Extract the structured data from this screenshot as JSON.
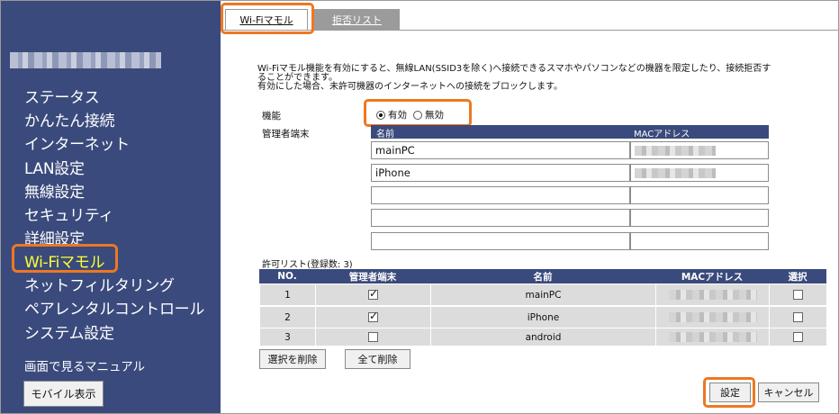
{
  "sidebar": {
    "nav": [
      {
        "label": "ステータス"
      },
      {
        "label": "かんたん接続"
      },
      {
        "label": "インターネット"
      },
      {
        "label": "LAN設定"
      },
      {
        "label": "無線設定"
      },
      {
        "label": "セキュリティ"
      },
      {
        "label": "詳細設定"
      },
      {
        "label": "Wi-Fiマモル"
      },
      {
        "label": "ネットフィルタリング"
      },
      {
        "label": "ペアレンタルコントロール"
      },
      {
        "label": "システム設定"
      }
    ],
    "active_index": 7,
    "manual_link": "画面で見るマニュアル",
    "mobile_button": "モバイル表示"
  },
  "tabs": [
    {
      "label": "Wi-Fiマモル"
    },
    {
      "label": "拒否リスト"
    }
  ],
  "description": [
    "Wi-Fiマモル機能を有効にすると、無線LAN(SSID3を除く)へ接続できるスマホやパソコンなどの機器を限定したり、接続拒否す",
    "ることができます。",
    "有効にした場合、未許可機器のインターネットへの接続をブロックします。"
  ],
  "function": {
    "label": "機能",
    "options": [
      "有効",
      "無効"
    ],
    "selected": "有効"
  },
  "admin": {
    "label": "管理者端末",
    "col_name": "名前",
    "col_mac": "MACアドレス",
    "rows": [
      {
        "name": "mainPC"
      },
      {
        "name": "iPhone"
      },
      {
        "name": ""
      },
      {
        "name": ""
      },
      {
        "name": ""
      }
    ]
  },
  "allow_list": {
    "caption": "許可リスト(登録数: 3)",
    "headers": [
      "NO.",
      "管理者端末",
      "名前",
      "MACアドレス",
      "選択"
    ],
    "rows": [
      {
        "no": "1",
        "admin": true,
        "name": "mainPC",
        "selected": false
      },
      {
        "no": "2",
        "admin": true,
        "name": "iPhone",
        "selected": false
      },
      {
        "no": "3",
        "admin": false,
        "name": "android",
        "selected": false
      }
    ]
  },
  "buttons": {
    "delete_selected": "選択を削除",
    "delete_all": "全て削除",
    "apply": "設定",
    "cancel": "キャンセル"
  },
  "colors": {
    "sidebar_bg": "#3a4a7c",
    "active_nav": "#ffff33",
    "highlight": "#ee7722"
  }
}
